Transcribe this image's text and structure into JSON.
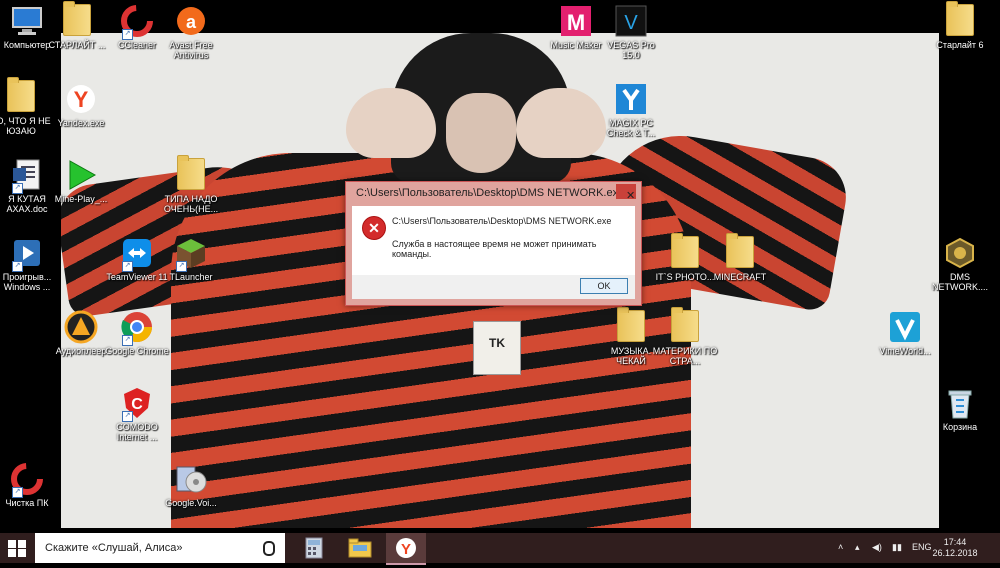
{
  "desktop": {
    "icons": [
      {
        "label": "Компьютер",
        "icon": "computer-icon"
      },
      {
        "label": "СТАРЛАЙТ ...",
        "icon": "folder-icon"
      },
      {
        "label": "CCleaner",
        "icon": "ccleaner-icon"
      },
      {
        "label": "Avast Free Antivirus",
        "icon": "avast-icon"
      },
      {
        "label": "ТО, ЧТО Я НЕ ЮЗАЮ",
        "icon": "folder-icon"
      },
      {
        "label": "Yandex.exe",
        "icon": "yandex-icon"
      },
      {
        "label": "Я КУТАЯ АХАХ.doc",
        "icon": "word-document-icon"
      },
      {
        "label": "Mine-Play_...",
        "icon": "play-arrow-icon"
      },
      {
        "label": "ТИПА НАДО ОЧЕНЬ(НЕ...",
        "icon": "folder-icon"
      },
      {
        "label": "Проигрыв... Windows ...",
        "icon": "media-player-icon"
      },
      {
        "label": "TeamViewer 11",
        "icon": "teamviewer-icon"
      },
      {
        "label": "TLauncher",
        "icon": "tlauncher-icon"
      },
      {
        "label": "Аудиоплеер",
        "icon": "aimp-icon"
      },
      {
        "label": "Google Chrome",
        "icon": "chrome-icon"
      },
      {
        "label": "COMODO Internet ...",
        "icon": "comodo-icon"
      },
      {
        "label": "Чистка ПК",
        "icon": "ccleaner-icon"
      },
      {
        "label": "Google.Voi...",
        "icon": "disc-installer-icon"
      },
      {
        "label": "Music Maker",
        "icon": "music-maker-icon"
      },
      {
        "label": "VEGAS Pro 15.0",
        "icon": "vegas-icon"
      },
      {
        "label": "MAGIX PC Check & T...",
        "icon": "magix-icon"
      },
      {
        "label": "IT`S PHOTO...",
        "icon": "folder-icon"
      },
      {
        "label": "MINECRAFT",
        "icon": "folder-icon"
      },
      {
        "label": "МУЗЫКА. ЧЕКАЙ",
        "icon": "folder-icon"
      },
      {
        "label": "МАТЕРИКИ ПО СТРА...",
        "icon": "folder-icon"
      },
      {
        "label": "Старлайт 6",
        "icon": "folder-icon"
      },
      {
        "label": "DMS NETWORK....",
        "icon": "dms-network-icon"
      },
      {
        "label": "VimeWorld...",
        "icon": "vimeworld-icon"
      },
      {
        "label": "Корзина",
        "icon": "recycle-bin-icon"
      }
    ],
    "wallpaper_patch_text": "TK"
  },
  "dialog": {
    "title": "C:\\Users\\Пользователь\\Desktop\\DMS NETWORK.exe",
    "close_glyph": "✕",
    "icon": "error-icon",
    "path": "C:\\Users\\Пользователь\\Desktop\\DMS NETWORK.exe",
    "message": "Служба в настоящее время не может принимать команды.",
    "ok_label": "OK"
  },
  "taskbar": {
    "search_placeholder": "Скажите «Слушай, Алиса»",
    "pinned": [
      "calculator-icon",
      "file-explorer-icon",
      "yandex-browser-icon"
    ],
    "tray_chevron": "˄",
    "language": "ENG",
    "time": "17:44",
    "date": "26.12.2018",
    "colors": {
      "taskbar": "#301e1e",
      "active_item": "#5a3b3b"
    }
  }
}
